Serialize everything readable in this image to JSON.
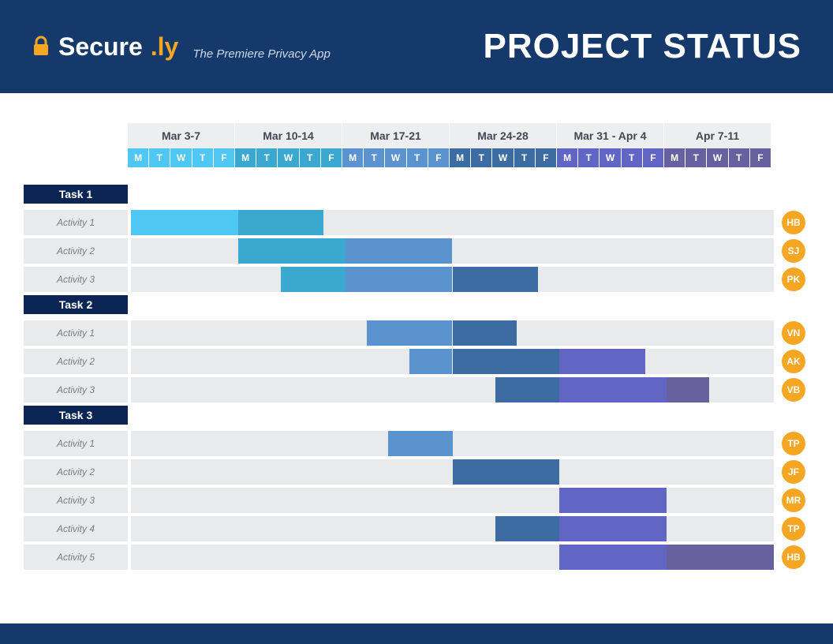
{
  "brand": {
    "name": "Secure",
    "suffix": ".ly",
    "tagline": "The Premiere Privacy App"
  },
  "title": "PROJECT STATUS",
  "weeks": [
    {
      "label": "Mar 3-7",
      "color": "#4fc7f3"
    },
    {
      "label": "Mar 10-14",
      "color": "#3ba9cf"
    },
    {
      "label": "Mar 17-21",
      "color": "#5b93cf"
    },
    {
      "label": "Mar 24-28",
      "color": "#3d6ca2"
    },
    {
      "label": "Mar 31 - Apr 4",
      "color": "#6166c5"
    },
    {
      "label": "Apr 7-11",
      "color": "#67619f"
    }
  ],
  "day_labels": [
    "M",
    "T",
    "W",
    "T",
    "F"
  ],
  "tasks": [
    {
      "name": "Task 1",
      "activities": [
        {
          "name": "Activity 1",
          "avatar": "HB",
          "bars": [
            {
              "start": 0,
              "span": 5,
              "color": "#4fc7f3"
            },
            {
              "start": 5,
              "span": 4,
              "color": "#3ba9cf"
            }
          ]
        },
        {
          "name": "Activity 2",
          "avatar": "SJ",
          "bars": [
            {
              "start": 5,
              "span": 5,
              "color": "#3ba9cf"
            },
            {
              "start": 10,
              "span": 5,
              "color": "#5b93cf"
            }
          ]
        },
        {
          "name": "Activity 3",
          "avatar": "PK",
          "bars": [
            {
              "start": 7,
              "span": 3,
              "color": "#3ba9cf"
            },
            {
              "start": 10,
              "span": 5,
              "color": "#5b93cf"
            },
            {
              "start": 15,
              "span": 4,
              "color": "#3d6ca2"
            }
          ]
        }
      ]
    },
    {
      "name": "Task 2",
      "activities": [
        {
          "name": "Activity 1",
          "avatar": "VN",
          "bars": [
            {
              "start": 11,
              "span": 4,
              "color": "#5b93cf"
            },
            {
              "start": 15,
              "span": 3,
              "color": "#3d6ca2"
            }
          ]
        },
        {
          "name": "Activity 2",
          "avatar": "AK",
          "bars": [
            {
              "start": 13,
              "span": 2,
              "color": "#5b93cf"
            },
            {
              "start": 15,
              "span": 5,
              "color": "#3d6ca2"
            },
            {
              "start": 20,
              "span": 4,
              "color": "#6166c5"
            }
          ]
        },
        {
          "name": "Activity 3",
          "avatar": "VB",
          "bars": [
            {
              "start": 17,
              "span": 3,
              "color": "#3d6ca2"
            },
            {
              "start": 20,
              "span": 5,
              "color": "#6166c5"
            },
            {
              "start": 25,
              "span": 2,
              "color": "#67619f"
            }
          ]
        }
      ]
    },
    {
      "name": "Task 3",
      "activities": [
        {
          "name": "Activity 1",
          "avatar": "TP",
          "bars": [
            {
              "start": 12,
              "span": 3,
              "color": "#5b93cf"
            }
          ]
        },
        {
          "name": "Activity 2",
          "avatar": "JF",
          "bars": [
            {
              "start": 15,
              "span": 5,
              "color": "#3d6ca2"
            }
          ]
        },
        {
          "name": "Activity 3",
          "avatar": "MR",
          "bars": [
            {
              "start": 20,
              "span": 5,
              "color": "#6166c5"
            }
          ]
        },
        {
          "name": "Activity 4",
          "avatar": "TP",
          "bars": [
            {
              "start": 17,
              "span": 3,
              "color": "#3d6ca2"
            },
            {
              "start": 20,
              "span": 5,
              "color": "#6166c5"
            }
          ]
        },
        {
          "name": "Activity 5",
          "avatar": "HB",
          "bars": [
            {
              "start": 20,
              "span": 5,
              "color": "#6166c5"
            },
            {
              "start": 25,
              "span": 5,
              "color": "#67619f"
            }
          ]
        }
      ]
    }
  ],
  "chart_data": {
    "type": "gantt",
    "total_units": 30,
    "unit": "workday",
    "weeks": [
      "Mar 3-7",
      "Mar 10-14",
      "Mar 17-21",
      "Mar 24-28",
      "Mar 31 - Apr 4",
      "Apr 7-11"
    ],
    "day_labels": [
      "M",
      "T",
      "W",
      "T",
      "F"
    ],
    "week_colors": [
      "#4fc7f3",
      "#3ba9cf",
      "#5b93cf",
      "#3d6ca2",
      "#6166c5",
      "#67619f"
    ],
    "series": [
      {
        "task": "Task 1",
        "activity": "Activity 1",
        "owner": "HB",
        "segments": [
          {
            "start": 0,
            "end": 5,
            "color": "#4fc7f3"
          },
          {
            "start": 5,
            "end": 9,
            "color": "#3ba9cf"
          }
        ]
      },
      {
        "task": "Task 1",
        "activity": "Activity 2",
        "owner": "SJ",
        "segments": [
          {
            "start": 5,
            "end": 10,
            "color": "#3ba9cf"
          },
          {
            "start": 10,
            "end": 15,
            "color": "#5b93cf"
          }
        ]
      },
      {
        "task": "Task 1",
        "activity": "Activity 3",
        "owner": "PK",
        "segments": [
          {
            "start": 7,
            "end": 10,
            "color": "#3ba9cf"
          },
          {
            "start": 10,
            "end": 15,
            "color": "#5b93cf"
          },
          {
            "start": 15,
            "end": 19,
            "color": "#3d6ca2"
          }
        ]
      },
      {
        "task": "Task 2",
        "activity": "Activity 1",
        "owner": "VN",
        "segments": [
          {
            "start": 11,
            "end": 15,
            "color": "#5b93cf"
          },
          {
            "start": 15,
            "end": 18,
            "color": "#3d6ca2"
          }
        ]
      },
      {
        "task": "Task 2",
        "activity": "Activity 2",
        "owner": "AK",
        "segments": [
          {
            "start": 13,
            "end": 15,
            "color": "#5b93cf"
          },
          {
            "start": 15,
            "end": 20,
            "color": "#3d6ca2"
          },
          {
            "start": 20,
            "end": 24,
            "color": "#6166c5"
          }
        ]
      },
      {
        "task": "Task 2",
        "activity": "Activity 3",
        "owner": "VB",
        "segments": [
          {
            "start": 17,
            "end": 20,
            "color": "#3d6ca2"
          },
          {
            "start": 20,
            "end": 25,
            "color": "#6166c5"
          },
          {
            "start": 25,
            "end": 27,
            "color": "#67619f"
          }
        ]
      },
      {
        "task": "Task 3",
        "activity": "Activity 1",
        "owner": "TP",
        "segments": [
          {
            "start": 12,
            "end": 15,
            "color": "#5b93cf"
          }
        ]
      },
      {
        "task": "Task 3",
        "activity": "Activity 2",
        "owner": "JF",
        "segments": [
          {
            "start": 15,
            "end": 20,
            "color": "#3d6ca2"
          }
        ]
      },
      {
        "task": "Task 3",
        "activity": "Activity 3",
        "owner": "MR",
        "segments": [
          {
            "start": 20,
            "end": 25,
            "color": "#6166c5"
          }
        ]
      },
      {
        "task": "Task 3",
        "activity": "Activity 4",
        "owner": "TP",
        "segments": [
          {
            "start": 17,
            "end": 20,
            "color": "#3d6ca2"
          },
          {
            "start": 20,
            "end": 25,
            "color": "#6166c5"
          }
        ]
      },
      {
        "task": "Task 3",
        "activity": "Activity 5",
        "owner": "HB",
        "segments": [
          {
            "start": 20,
            "end": 25,
            "color": "#6166c5"
          },
          {
            "start": 25,
            "end": 30,
            "color": "#67619f"
          }
        ]
      }
    ],
    "title": "PROJECT STATUS"
  }
}
